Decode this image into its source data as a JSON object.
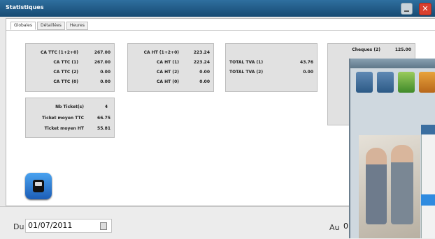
{
  "window": {
    "title": "Statistiques"
  },
  "tabs": [
    "Globales",
    "Détaillées",
    "Heures"
  ],
  "ttc_block": [
    {
      "label": "CA TTC (1+2+0)",
      "value": "267.00"
    },
    {
      "label": "CA TTC (1)",
      "value": "267.00"
    },
    {
      "label": "CA TTC (2)",
      "value": "0.00"
    },
    {
      "label": "CA TTC (0)",
      "value": "0.00"
    }
  ],
  "ht_block": [
    {
      "label": "CA HT (1+2+0)",
      "value": "223.24"
    },
    {
      "label": "CA HT (1)",
      "value": "223.24"
    },
    {
      "label": "CA HT (2)",
      "value": "0.00"
    },
    {
      "label": "CA HT (0)",
      "value": "0.00"
    }
  ],
  "tva_block": [
    {
      "label": "TOTAL TVA (1)",
      "value": "43.76"
    },
    {
      "label": "TOTAL TVA (2)",
      "value": "0.00"
    }
  ],
  "ticket_block": [
    {
      "label": "Nb Ticket(s)",
      "value": "4"
    },
    {
      "label": "Ticket moyen TTC",
      "value": "66.75"
    },
    {
      "label": "Ticket moyen HT",
      "value": "55.81"
    }
  ],
  "payment_block": [
    {
      "label": "Cheques (2)",
      "value": "125.00"
    }
  ],
  "bottom": {
    "du_label": "Du",
    "du_value": "01/07/2011",
    "au_label": "Au",
    "au_value": "0"
  },
  "icons": {
    "minimize": "minimize-icon",
    "close": "close-icon",
    "calendar": "calendar-icon",
    "app": "cash-register-icon"
  }
}
